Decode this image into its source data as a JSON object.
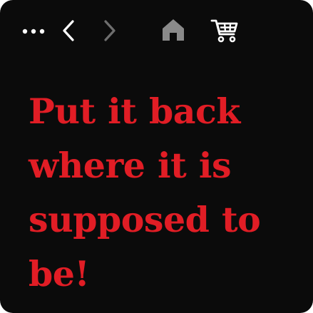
{
  "toolbar": {
    "icons": {
      "more": "more-horizontal-icon",
      "back": "chevron-left-icon",
      "forward": "chevron-right-icon",
      "home": "home-icon",
      "cart": "shopping-cart-icon"
    },
    "forward_enabled": false
  },
  "message": {
    "text": "Put it back where it is supposed to be!"
  },
  "colors": {
    "background": "#0b0b0b",
    "message_text": "#e11d25",
    "icon_active": "#ffffff",
    "icon_disabled": "#6e6e6e"
  }
}
